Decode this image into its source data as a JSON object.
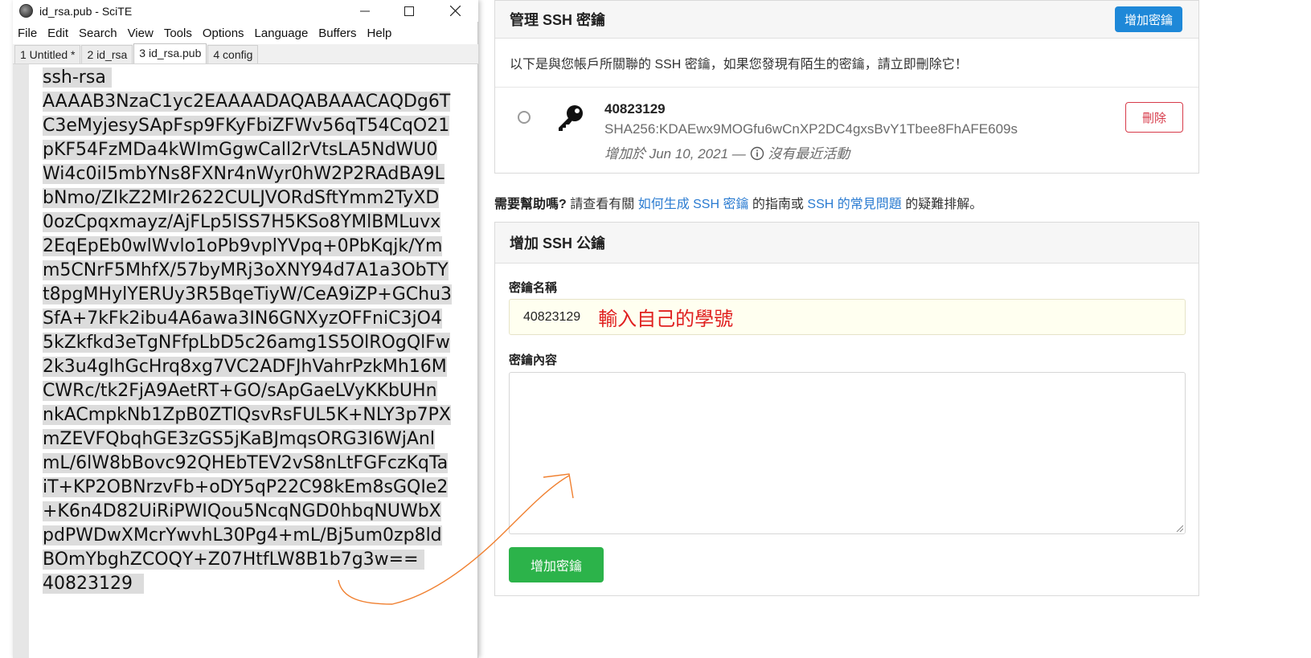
{
  "editor_window": {
    "title": "id_rsa.pub - SciTE",
    "menu": [
      "File",
      "Edit",
      "Search",
      "View",
      "Tools",
      "Options",
      "Language",
      "Buffers",
      "Help"
    ],
    "tabs": [
      "1 Untitled *",
      "2 id_rsa",
      "3 id_rsa.pub",
      "4 config"
    ],
    "active_tab": "3 id_rsa.pub",
    "lines": [
      "ssh-rsa ",
      "AAAAB3NzaC1yc2EAAAADAQABAAACAQDg6T",
      "C3eMyjesySApFsp9FKyFbiZFWv56qT54CqO21",
      "pKF54FzMDa4kWImGgwCall2rVtsLA5NdWU0",
      "Wi4c0iI5mbYNs8FXNr4nWyr0hW2P2RAdBA9L",
      "bNmo/ZIkZ2MIr2622CULJVORdSftYmm2TyXD",
      "0ozCpqxmayz/AjFLp5lSS7H5KSo8YMlBMLuvx",
      "2EqEpEb0wlWvlo1oPb9vplYVpq+0PbKqjk/Ym",
      "m5CNrF5MhfX/57byMRj3oXNY94d7A1a3ObTY",
      "t8pgMHylYERUy3R5BqeTiyW/CeA9iZP+GChu3",
      "SfA+7kFk2ibu4A6awa3IN6GNXyzOFFniC3jO4",
      "5kZkfkd3eTgNFfpLbD5c26amg1S5OlROgQlFw",
      "2k3u4glhGcHrq8xg7VC2ADFJhVahrPzkMh16M",
      "CWRc/tk2FjA9AetRT+GO/sApGaeLVyKKbUHn",
      "nkACmpkNb1ZpB0ZTlQsvRsFUL5K+NLY3p7PX",
      "mZEVFQbqhGE3zGS5jKaBJmqsORG3I6WjAnl",
      "mL/6lW8bBovc92QHEbTEV2vS8nLtFGFczKqTa",
      "iT+KP2OBNrzvFb+oDY5qP22C98kEm8sGQIe2",
      "+K6n4D82UiRiPWIQou5NcqNGD0hbqNUWbX",
      "pdPWDwXMcrYwvhL30Pg4+mL/Bj5um0zp8ld",
      "BOmYbghZCOQY+Z07HtfLW8B1b7g3w== ",
      "40823129  "
    ]
  },
  "ssh_keys_panel": {
    "title": "管理 SSH 密鑰",
    "add_button": "增加密鑰",
    "notice": "以下是與您帳戶所關聯的 SSH 密鑰，如果您發現有陌生的密鑰，請立即刪除它！",
    "key": {
      "name": "40823129",
      "fingerprint": "SHA256:KDAEwx9MOGfu6wCnXP2DC4gxsBvY1Tbee8FhAFE609s",
      "added": "增加於 Jun 10, 2021 —",
      "activity": "沒有最近活動",
      "delete_button": "刪除"
    }
  },
  "help": {
    "lead": "需要幫助嗎?",
    "text1": " 請查看有關 ",
    "link1": "如何生成 SSH 密鑰",
    "text2": " 的指南或 ",
    "link2": "SSH 的常見問題",
    "text3": " 的疑難排解。"
  },
  "add_key_panel": {
    "title": "增加 SSH 公鑰",
    "name_label": "密鑰名稱",
    "name_value": "40823129",
    "annotation": "輸入自己的學號",
    "content_label": "密鑰內容",
    "submit_button": "增加密鑰"
  },
  "colors": {
    "primary": "#1e88d8",
    "danger": "#d73a49",
    "success": "#2cb34a",
    "link": "#2a7bd1",
    "annotation": "#e02020",
    "arrow": "#f08030"
  }
}
